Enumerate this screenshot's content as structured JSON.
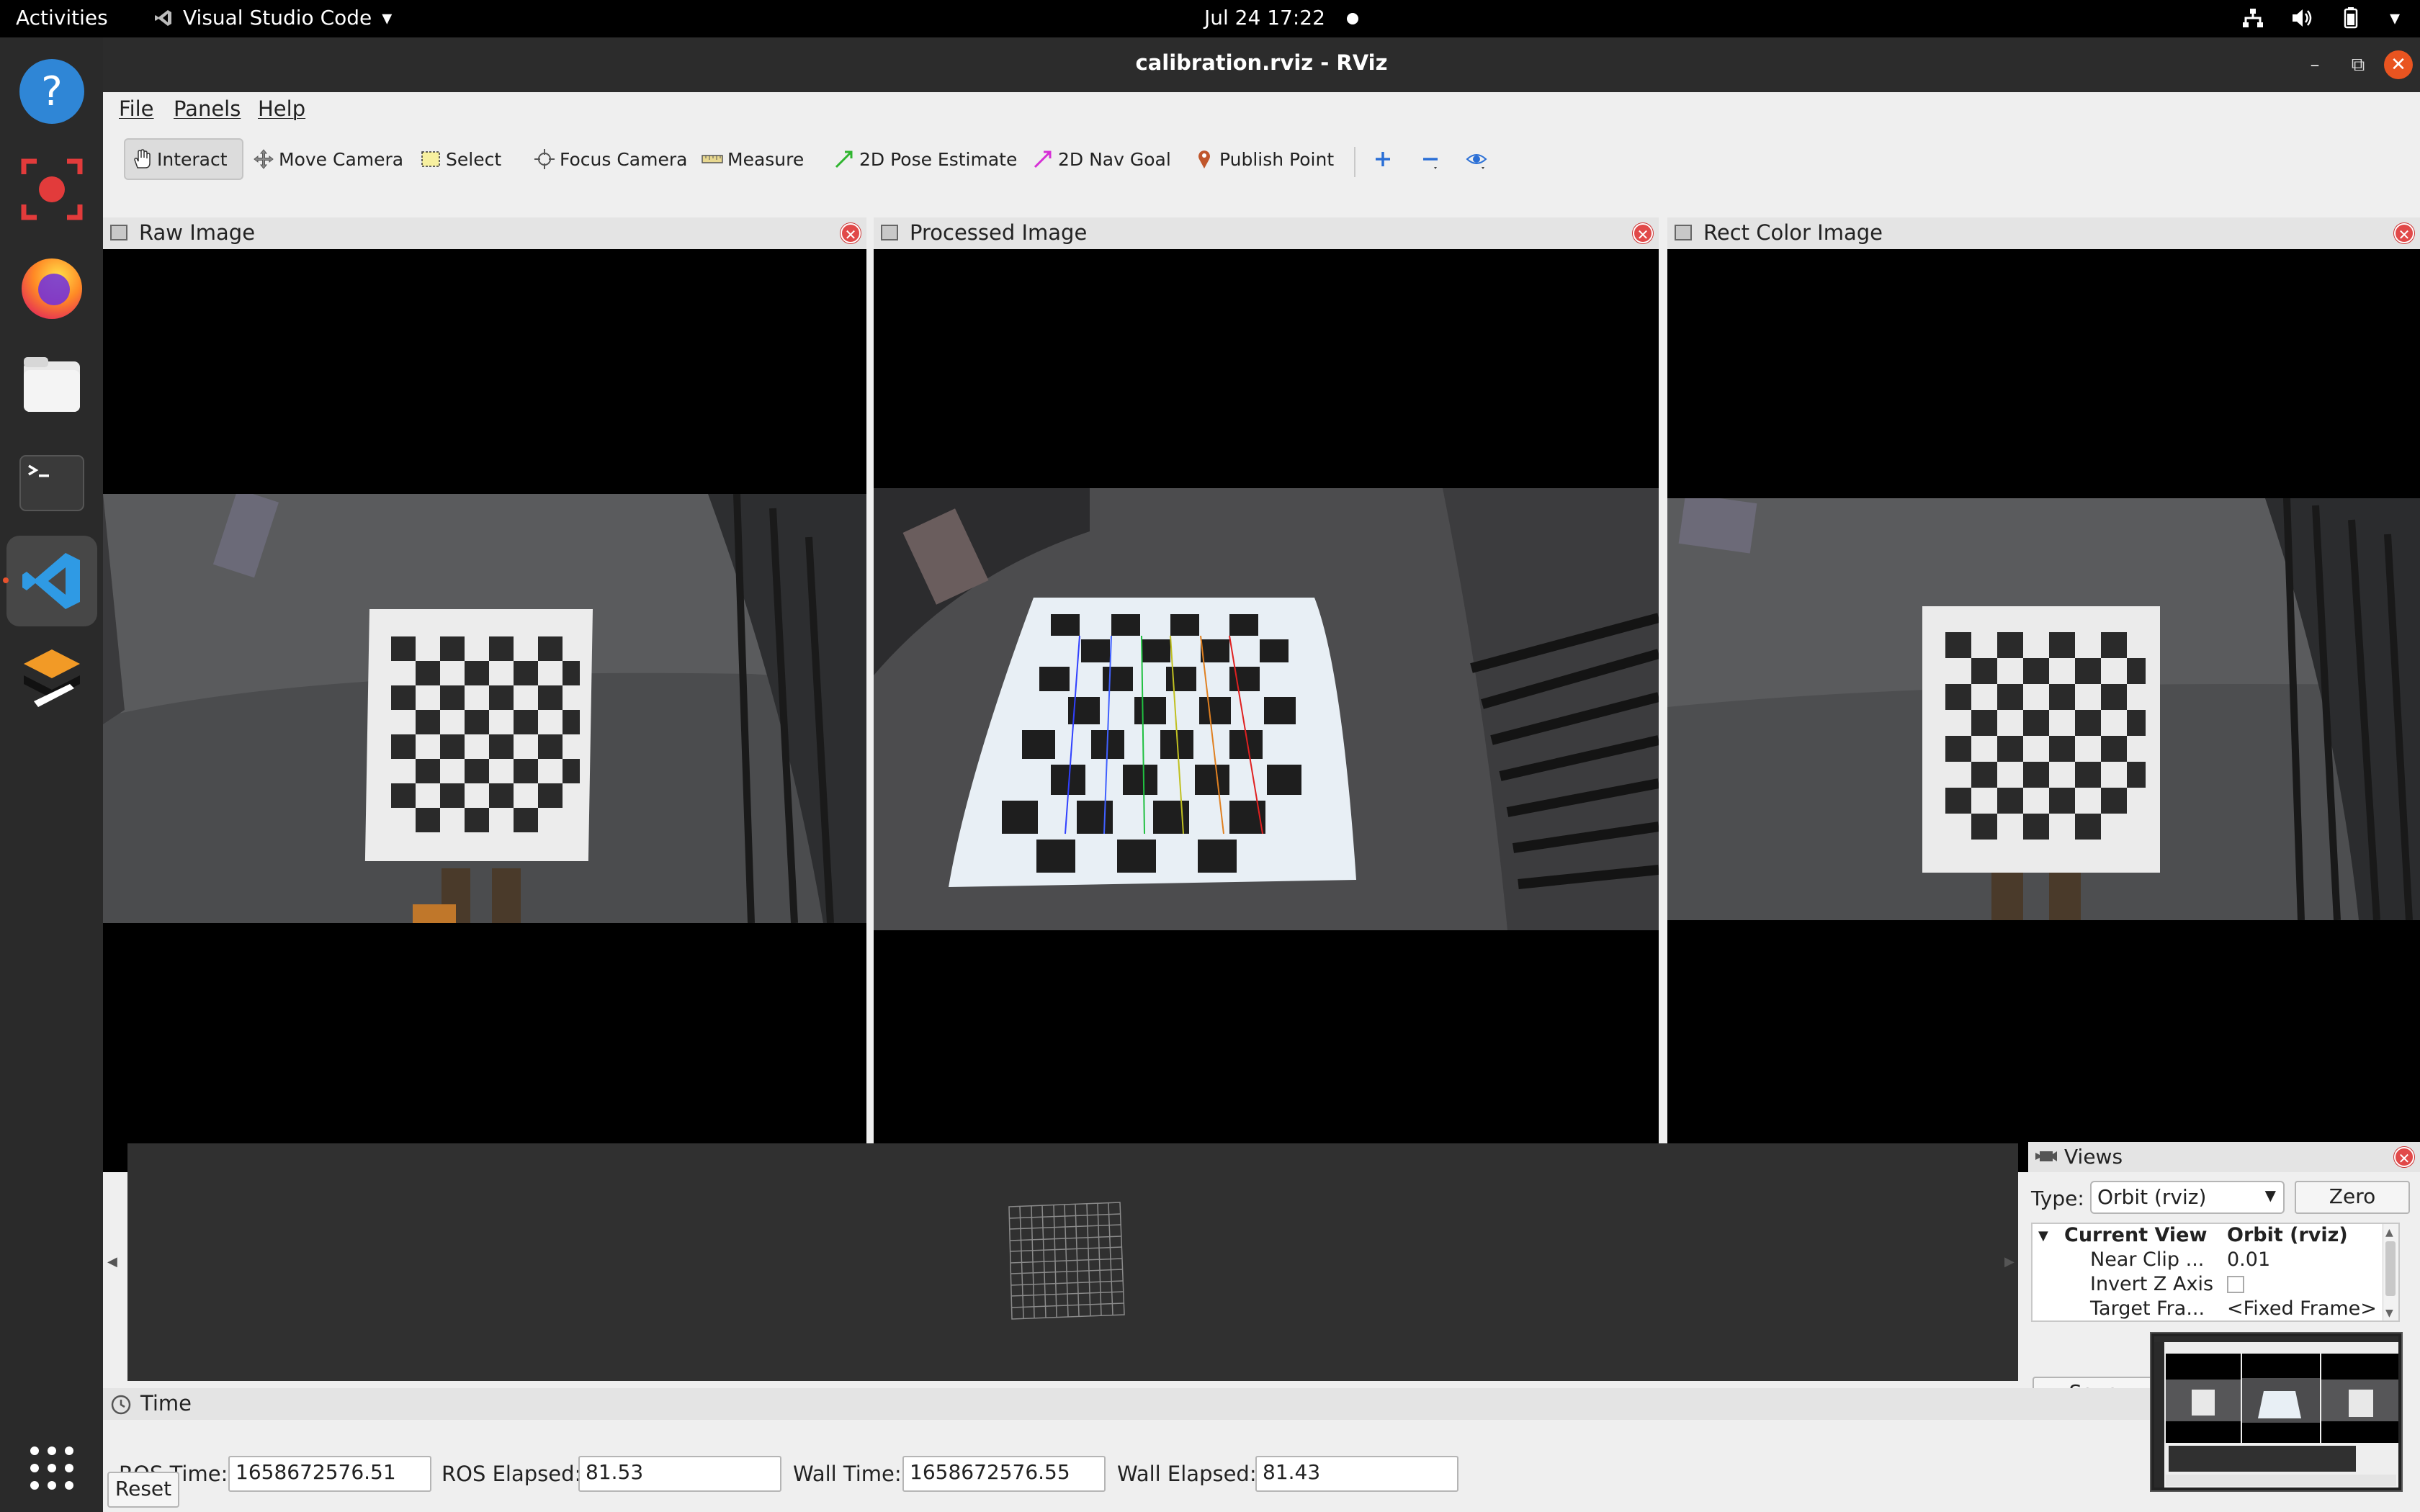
{
  "topbar": {
    "activities": "Activities",
    "app_menu": "Visual Studio Code",
    "clock": "Jul 24  17:22"
  },
  "dock": {
    "items": [
      "help-icon",
      "screen-recorder-icon",
      "firefox-icon",
      "files-icon",
      "terminal-icon",
      "vscode-icon",
      "app-icon",
      "show-apps-icon"
    ]
  },
  "window": {
    "title": "calibration.rviz - RViz"
  },
  "menubar": {
    "file": "File",
    "panels": "Panels",
    "help": "Help"
  },
  "toolbar": {
    "interact": "Interact",
    "move_camera": "Move Camera",
    "select": "Select",
    "focus_camera": "Focus Camera",
    "measure": "Measure",
    "pose_estimate": "2D Pose Estimate",
    "nav_goal": "2D Nav Goal",
    "publish_point": "Publish Point"
  },
  "panels": {
    "raw": {
      "title": "Raw Image"
    },
    "processed": {
      "title": "Processed Image"
    },
    "rect": {
      "title": "Rect Color Image"
    }
  },
  "views": {
    "title": "Views",
    "type_label": "Type:",
    "type_value": "Orbit (rviz)",
    "zero_button": "Zero",
    "save_button": "Save",
    "tree": {
      "current_view": "Current View",
      "current_view_value": "Orbit (rviz)",
      "near_clip": "Near Clip ...",
      "near_clip_value": "0.01",
      "invert_z": "Invert Z Axis",
      "target_frame": "Target Fra...",
      "target_frame_value": "<Fixed Frame>"
    }
  },
  "time": {
    "title": "Time",
    "ros_time_label": "ROS Time:",
    "ros_time_value": "1658672576.51",
    "ros_elapsed_label": "ROS Elapsed:",
    "ros_elapsed_value": "81.53",
    "wall_time_label": "Wall Time:",
    "wall_time_value": "1658672576.55",
    "wall_elapsed_label": "Wall Elapsed:",
    "wall_elapsed_value": "81.43",
    "reset_button": "Reset"
  },
  "colors": {
    "accent": "#e95420",
    "panel_close": "#e14949",
    "vscode_blue": "#2f9ae4"
  }
}
